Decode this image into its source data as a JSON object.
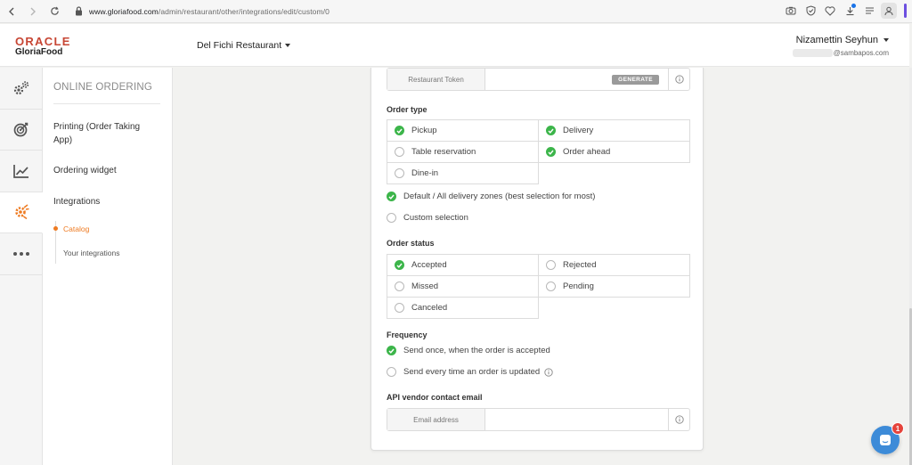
{
  "browser": {
    "url_host": "www.gloriafood.com",
    "url_path": "/admin/restaurant/other/integrations/edit/custom/0"
  },
  "header": {
    "logo_brand": "ORACLE",
    "logo_product": "GloriaFood",
    "restaurant_name": "Del Fichi Restaurant",
    "user_name": "Nizamettin Seyhun",
    "user_email_domain": "@sambapos.com"
  },
  "rail": {
    "items": [
      {
        "icon": "gears-icon",
        "active": false
      },
      {
        "icon": "target-icon",
        "active": false
      },
      {
        "icon": "chart-line-icon",
        "active": false
      },
      {
        "icon": "integrations-icon",
        "active": true
      },
      {
        "icon": "more-icon",
        "active": false
      }
    ]
  },
  "subnav": {
    "section_title": "ONLINE ORDERING",
    "links": {
      "printing": "Printing (Order Taking App)",
      "ordering_widget": "Ordering widget",
      "integrations": "Integrations"
    },
    "tree": {
      "catalog": "Catalog",
      "your_integrations": "Your integrations"
    }
  },
  "form": {
    "token": {
      "label": "Restaurant Token",
      "value": "",
      "generate_label": "GENERATE"
    },
    "order_type": {
      "title": "Order type",
      "options": [
        {
          "label": "Pickup",
          "checked": true
        },
        {
          "label": "Delivery",
          "checked": true
        },
        {
          "label": "Table reservation",
          "checked": false
        },
        {
          "label": "Order ahead",
          "checked": true
        },
        {
          "label": "Dine-in",
          "checked": false
        }
      ]
    },
    "zones": {
      "options": [
        {
          "label": "Default / All delivery zones (best selection for most)",
          "selected": true
        },
        {
          "label": "Custom selection",
          "selected": false
        }
      ]
    },
    "order_status": {
      "title": "Order status",
      "options": [
        {
          "label": "Accepted",
          "checked": true
        },
        {
          "label": "Rejected",
          "checked": false
        },
        {
          "label": "Missed",
          "checked": false
        },
        {
          "label": "Pending",
          "checked": false
        },
        {
          "label": "Canceled",
          "checked": false
        }
      ]
    },
    "frequency": {
      "title": "Frequency",
      "options": [
        {
          "label": "Send once, when the order is accepted",
          "selected": true
        },
        {
          "label": "Send every time an order is updated",
          "selected": false
        }
      ]
    },
    "vendor_email": {
      "title": "API vendor contact email",
      "label": "Email address",
      "value": ""
    }
  },
  "chat": {
    "badge_count": "1"
  },
  "colors": {
    "brand_red": "#c74634",
    "accent_orange": "#ee7b22",
    "check_green": "#3cb54a",
    "chat_blue": "#3d8bd8",
    "badge_red": "#e5433b"
  }
}
